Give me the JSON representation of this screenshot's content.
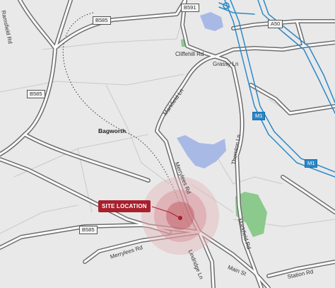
{
  "map": {
    "site_callout": "SITE LOCATION",
    "road_labels": {
      "ramsfield_rd": "Ramsfield Rd",
      "cliffehill_rd": "Cliffehill Rd",
      "grassy_ln": "Grassy Ln",
      "markfield_ln": "Markfield Ln",
      "merrylees_rd_north": "Merrylees Rd",
      "merrylees_rd_south": "Merrylees Rd",
      "thornton_ln": "Thornton Ln",
      "markfield_rd": "Markfield Rd",
      "lindridge_ln": "Lindridge Ln",
      "main_st": "Main St",
      "station_rd": "Station Rd"
    },
    "place_labels": {
      "bagworth": "Bagworth"
    },
    "road_shields": {
      "b585_top": "B585",
      "b585_left": "B585",
      "b585_bottom": "B585",
      "b591": "B591",
      "a50": "A50",
      "m1_center": "M1",
      "m1_right": "M1"
    },
    "colors": {
      "background": "#e9e9e9",
      "road_casing": "#6e6e6e",
      "road_fill": "#ffffff",
      "motorway": "#2a88c8",
      "water": "#a9b9e6",
      "park": "#8cc98c",
      "site_marker": "#a8202c",
      "site_halo": "#e3b4b8"
    }
  }
}
